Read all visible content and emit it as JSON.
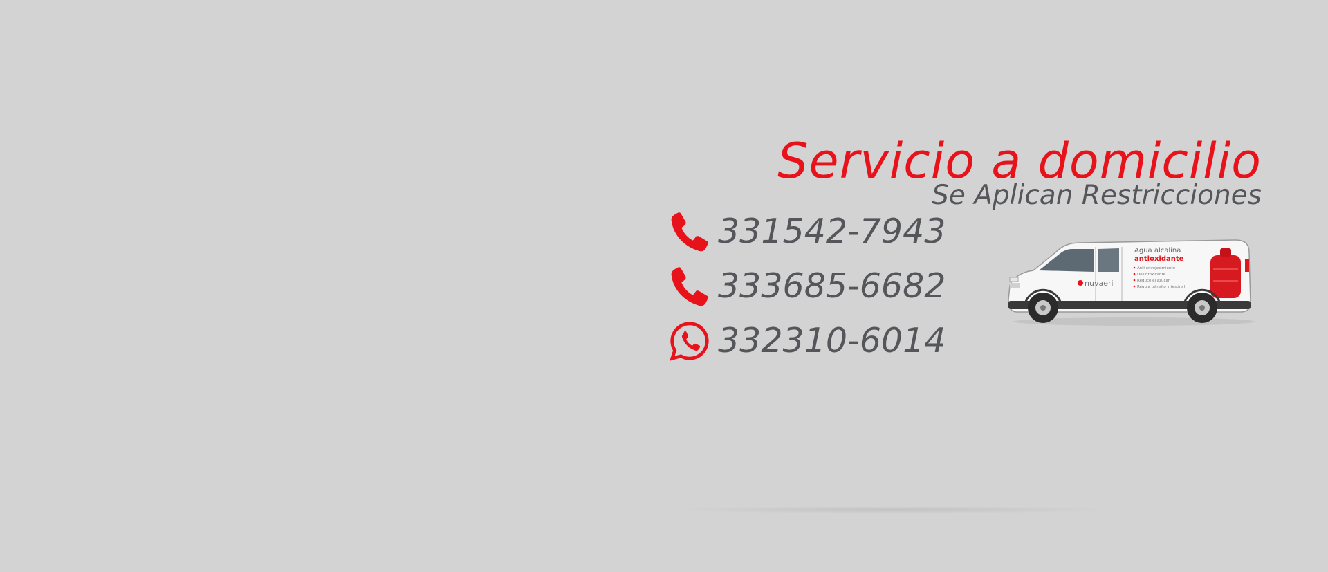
{
  "banner": {
    "title": "Servicio a domicilio",
    "subtitle": "Se Aplican Restricciones",
    "contacts": [
      {
        "icon": "phone-icon",
        "number": "331542-7943"
      },
      {
        "icon": "phone-icon",
        "number": "333685-6682"
      },
      {
        "icon": "whatsapp-icon",
        "number": "332310-6014"
      }
    ],
    "van": {
      "brand": "nuvaeri",
      "headline": "Agua alcalina",
      "highlight": "antioxidante",
      "benefits": [
        "Anti envejecimiento",
        "Desintoxicante",
        "Reduce el azúcar",
        "Regula tránsito intestinal"
      ]
    },
    "colors": {
      "accent": "#e8121b",
      "text": "#55565a",
      "background": "#d3d3d3"
    }
  }
}
